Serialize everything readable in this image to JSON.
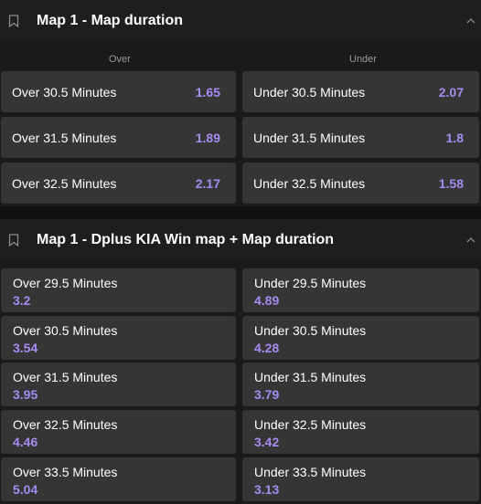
{
  "market1": {
    "title": "Map 1 - Map duration",
    "over_header": "Over",
    "under_header": "Under",
    "rows": [
      {
        "over_label": "Over 30.5 Minutes",
        "over_price": "1.65",
        "under_label": "Under 30.5 Minutes",
        "under_price": "2.07"
      },
      {
        "over_label": "Over 31.5 Minutes",
        "over_price": "1.89",
        "under_label": "Under 31.5 Minutes",
        "under_price": "1.8"
      },
      {
        "over_label": "Over 32.5 Minutes",
        "over_price": "2.17",
        "under_label": "Under 32.5 Minutes",
        "under_price": "1.58"
      }
    ]
  },
  "market2": {
    "title": "Map 1 - Dplus KIA Win map + Map duration",
    "rows": [
      {
        "over_label": "Over 29.5 Minutes",
        "over_price": "3.2",
        "under_label": "Under 29.5 Minutes",
        "under_price": "4.89"
      },
      {
        "over_label": "Over 30.5 Minutes",
        "over_price": "3.54",
        "under_label": "Under 30.5 Minutes",
        "under_price": "4.28"
      },
      {
        "over_label": "Over 31.5 Minutes",
        "over_price": "3.95",
        "under_label": "Under 31.5 Minutes",
        "under_price": "3.79"
      },
      {
        "over_label": "Over 32.5 Minutes",
        "over_price": "4.46",
        "under_label": "Under 32.5 Minutes",
        "under_price": "3.42"
      },
      {
        "over_label": "Over 33.5 Minutes",
        "over_price": "5.04",
        "under_label": "Under 33.5 Minutes",
        "under_price": "3.13"
      }
    ]
  },
  "icons": {
    "bookmark": "bookmark-icon",
    "collapse": "chevron-up-icon"
  },
  "colors": {
    "price": "#a48cf0",
    "cell": "#353535",
    "header": "#1e1e1e"
  }
}
